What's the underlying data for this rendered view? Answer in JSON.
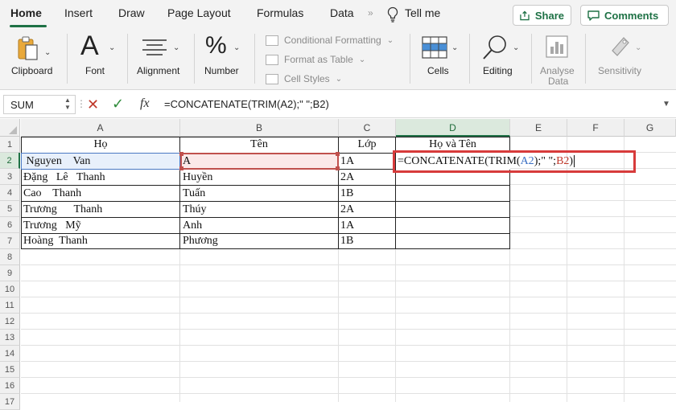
{
  "tabs": {
    "items": [
      "Home",
      "Insert",
      "Draw",
      "Page Layout",
      "Formulas",
      "Data"
    ],
    "more": "»",
    "tell_me": "Tell me",
    "share": "Share",
    "comments": "Comments"
  },
  "ribbon": {
    "clipboard": "Clipboard",
    "font": "Font",
    "alignment": "Alignment",
    "number": "Number",
    "number_symbol": "%",
    "font_symbol": "A",
    "conditional_formatting": "Conditional Formatting",
    "format_as_table": "Format as Table",
    "cell_styles": "Cell Styles",
    "cells": "Cells",
    "editing": "Editing",
    "analyse_data_line1": "Analyse",
    "analyse_data_line2": "Data",
    "sensitivity": "Sensitivity"
  },
  "formula_bar": {
    "name_box": "SUM",
    "fx": "fx",
    "formula": "=CONCATENATE(TRIM(A2);\" \";B2)"
  },
  "sheet": {
    "columns": [
      "A",
      "B",
      "C",
      "D",
      "E",
      "F",
      "G"
    ],
    "rows": [
      "1",
      "2",
      "3",
      "4",
      "5",
      "6",
      "7",
      "8",
      "9",
      "10",
      "11",
      "12",
      "13",
      "14",
      "15",
      "16",
      "17"
    ],
    "headers": {
      "a": "Họ",
      "b": "Tên",
      "c": "Lớp",
      "d": "Họ và Tên"
    },
    "data": [
      {
        "a": " Nguyen    Van",
        "b": "A",
        "c": "1A"
      },
      {
        "a": "Đặng   Lê   Thanh",
        "b": "Huyền",
        "c": "2A"
      },
      {
        "a": "Cao    Thanh",
        "b": "Tuấn",
        "c": "1B"
      },
      {
        "a": "Trương      Thanh",
        "b": "Thúy",
        "c": "2A"
      },
      {
        "a": "Trương   Mỹ",
        "b": "Anh",
        "c": "1A"
      },
      {
        "a": "Hoàng  Thanh",
        "b": "Phương",
        "c": "1B"
      }
    ],
    "d2_edit": {
      "prefix": "=CONCATENATE(TRIM(",
      "ref_a": "A2",
      "mid": ");\" \";",
      "ref_b": "B2",
      "suffix": ")"
    }
  }
}
